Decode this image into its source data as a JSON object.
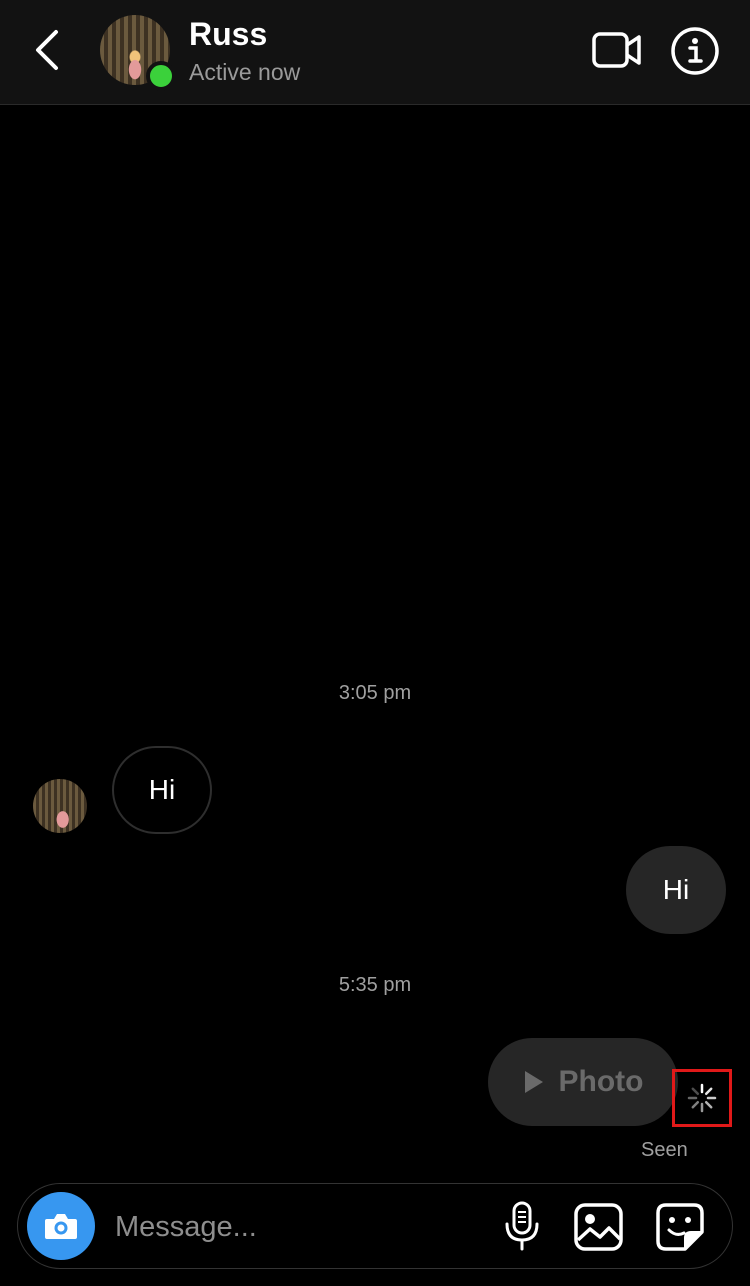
{
  "header": {
    "contact_name": "Russ",
    "status": "Active now"
  },
  "messages": {
    "time_1": "3:05 pm",
    "incoming_text": "Hi",
    "outgoing_text": "Hi",
    "time_2": "5:35 pm",
    "photo_label": "Photo",
    "seen_label": "Seen"
  },
  "composer": {
    "placeholder": "Message..."
  },
  "colors": {
    "online": "#3bd13b",
    "camera_button": "#3797f0",
    "highlight_box": "#e01919"
  },
  "icons": [
    "back-arrow-icon",
    "video-camera-icon",
    "info-icon",
    "play-icon",
    "loading-spinner-icon",
    "camera-icon",
    "microphone-icon",
    "gallery-icon",
    "sticker-icon"
  ]
}
